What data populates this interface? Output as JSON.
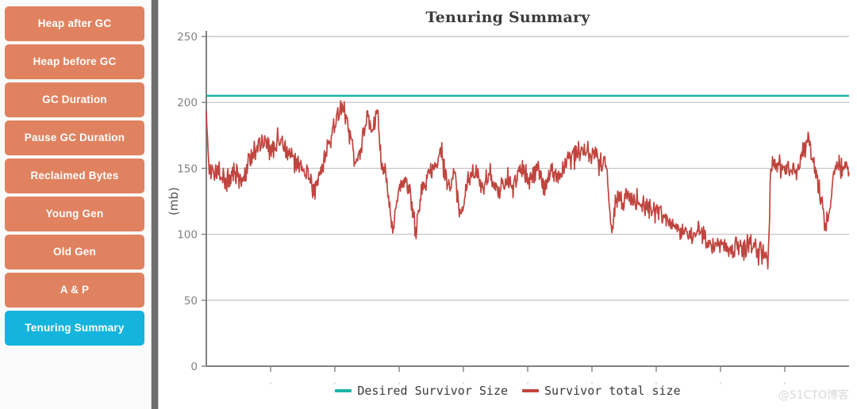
{
  "sidebar": {
    "items": [
      {
        "label": "Heap after GC",
        "active": false
      },
      {
        "label": "Heap before GC",
        "active": false
      },
      {
        "label": "GC Duration",
        "active": false
      },
      {
        "label": "Pause GC Duration",
        "active": false
      },
      {
        "label": "Reclaimed Bytes",
        "active": false
      },
      {
        "label": "Young Gen",
        "active": false
      },
      {
        "label": "Old Gen",
        "active": false
      },
      {
        "label": "A & P",
        "active": false
      },
      {
        "label": "Tenuring Summary",
        "active": true
      }
    ],
    "colors": {
      "button": "#e0825f",
      "button_active": "#14b4dd",
      "text": "#ffffff"
    }
  },
  "watermark": "@51CTO博客",
  "chart_data": {
    "type": "line",
    "title": "Tenuring Summary",
    "xlabel": "",
    "ylabel": "(mb)",
    "ylim": [
      0,
      250
    ],
    "yticks": [
      0,
      50,
      100,
      150,
      200,
      250
    ],
    "ytick_labels": [
      "0",
      "50",
      "100",
      "150",
      "200",
      "250"
    ],
    "grid": true,
    "grid_axis": "y",
    "xticks_count": 9,
    "xtick_labels": [],
    "legend_position": "bottom",
    "colors": {
      "desired": "#1ab5a8",
      "survivor": "#c0453f",
      "grid": "#c9c9c9",
      "axis": "#808080"
    },
    "series": [
      {
        "name": "Desired Survivor Size",
        "color": "#1ab5a8",
        "type": "constant",
        "value": 205
      },
      {
        "name": "Survivor total size",
        "color": "#c0453f",
        "type": "noisy-line",
        "noise_amplitude": 7,
        "noise_seed": 20240517,
        "samples": 1100,
        "control_points": [
          {
            "x": 0.0,
            "y": 196
          },
          {
            "x": 0.004,
            "y": 152
          },
          {
            "x": 0.012,
            "y": 146
          },
          {
            "x": 0.02,
            "y": 151
          },
          {
            "x": 0.03,
            "y": 138
          },
          {
            "x": 0.042,
            "y": 147
          },
          {
            "x": 0.055,
            "y": 139
          },
          {
            "x": 0.07,
            "y": 160
          },
          {
            "x": 0.085,
            "y": 169
          },
          {
            "x": 0.1,
            "y": 166
          },
          {
            "x": 0.115,
            "y": 170
          },
          {
            "x": 0.13,
            "y": 163
          },
          {
            "x": 0.145,
            "y": 152
          },
          {
            "x": 0.158,
            "y": 146
          },
          {
            "x": 0.168,
            "y": 133
          },
          {
            "x": 0.178,
            "y": 146
          },
          {
            "x": 0.19,
            "y": 168
          },
          {
            "x": 0.202,
            "y": 185
          },
          {
            "x": 0.212,
            "y": 197
          },
          {
            "x": 0.222,
            "y": 182
          },
          {
            "x": 0.232,
            "y": 152
          },
          {
            "x": 0.24,
            "y": 166
          },
          {
            "x": 0.25,
            "y": 190
          },
          {
            "x": 0.258,
            "y": 175
          },
          {
            "x": 0.266,
            "y": 197
          },
          {
            "x": 0.272,
            "y": 158
          },
          {
            "x": 0.28,
            "y": 143
          },
          {
            "x": 0.29,
            "y": 102
          },
          {
            "x": 0.3,
            "y": 136
          },
          {
            "x": 0.31,
            "y": 141
          },
          {
            "x": 0.318,
            "y": 128
          },
          {
            "x": 0.326,
            "y": 100
          },
          {
            "x": 0.334,
            "y": 134
          },
          {
            "x": 0.344,
            "y": 143
          },
          {
            "x": 0.356,
            "y": 152
          },
          {
            "x": 0.366,
            "y": 163
          },
          {
            "x": 0.376,
            "y": 133
          },
          {
            "x": 0.386,
            "y": 146
          },
          {
            "x": 0.396,
            "y": 115
          },
          {
            "x": 0.406,
            "y": 140
          },
          {
            "x": 0.418,
            "y": 150
          },
          {
            "x": 0.43,
            "y": 133
          },
          {
            "x": 0.442,
            "y": 146
          },
          {
            "x": 0.454,
            "y": 128
          },
          {
            "x": 0.466,
            "y": 142
          },
          {
            "x": 0.478,
            "y": 136
          },
          {
            "x": 0.49,
            "y": 152
          },
          {
            "x": 0.502,
            "y": 140
          },
          {
            "x": 0.514,
            "y": 150
          },
          {
            "x": 0.526,
            "y": 136
          },
          {
            "x": 0.538,
            "y": 148
          },
          {
            "x": 0.55,
            "y": 143
          },
          {
            "x": 0.562,
            "y": 155
          },
          {
            "x": 0.574,
            "y": 160
          },
          {
            "x": 0.586,
            "y": 166
          },
          {
            "x": 0.596,
            "y": 157
          },
          {
            "x": 0.606,
            "y": 162
          },
          {
            "x": 0.614,
            "y": 150
          },
          {
            "x": 0.622,
            "y": 156
          },
          {
            "x": 0.63,
            "y": 104
          },
          {
            "x": 0.638,
            "y": 130
          },
          {
            "x": 0.646,
            "y": 122
          },
          {
            "x": 0.654,
            "y": 130
          },
          {
            "x": 0.664,
            "y": 126
          },
          {
            "x": 0.676,
            "y": 124
          },
          {
            "x": 0.688,
            "y": 121
          },
          {
            "x": 0.7,
            "y": 118
          },
          {
            "x": 0.712,
            "y": 112
          },
          {
            "x": 0.724,
            "y": 108
          },
          {
            "x": 0.736,
            "y": 104
          },
          {
            "x": 0.748,
            "y": 101
          },
          {
            "x": 0.76,
            "y": 99
          },
          {
            "x": 0.77,
            "y": 103
          },
          {
            "x": 0.778,
            "y": 94
          },
          {
            "x": 0.79,
            "y": 90
          },
          {
            "x": 0.802,
            "y": 92
          },
          {
            "x": 0.814,
            "y": 89
          },
          {
            "x": 0.826,
            "y": 91
          },
          {
            "x": 0.838,
            "y": 88
          },
          {
            "x": 0.85,
            "y": 90
          },
          {
            "x": 0.86,
            "y": 86
          },
          {
            "x": 0.868,
            "y": 88
          },
          {
            "x": 0.874,
            "y": 76
          },
          {
            "x": 0.878,
            "y": 150
          },
          {
            "x": 0.888,
            "y": 152
          },
          {
            "x": 0.898,
            "y": 148
          },
          {
            "x": 0.908,
            "y": 152
          },
          {
            "x": 0.918,
            "y": 147
          },
          {
            "x": 0.928,
            "y": 165
          },
          {
            "x": 0.936,
            "y": 172
          },
          {
            "x": 0.942,
            "y": 160
          },
          {
            "x": 0.95,
            "y": 140
          },
          {
            "x": 0.958,
            "y": 122
          },
          {
            "x": 0.964,
            "y": 105
          },
          {
            "x": 0.97,
            "y": 120
          },
          {
            "x": 0.976,
            "y": 147
          },
          {
            "x": 0.982,
            "y": 152
          },
          {
            "x": 0.988,
            "y": 146
          },
          {
            "x": 0.994,
            "y": 153
          },
          {
            "x": 1.0,
            "y": 145
          }
        ]
      }
    ]
  }
}
